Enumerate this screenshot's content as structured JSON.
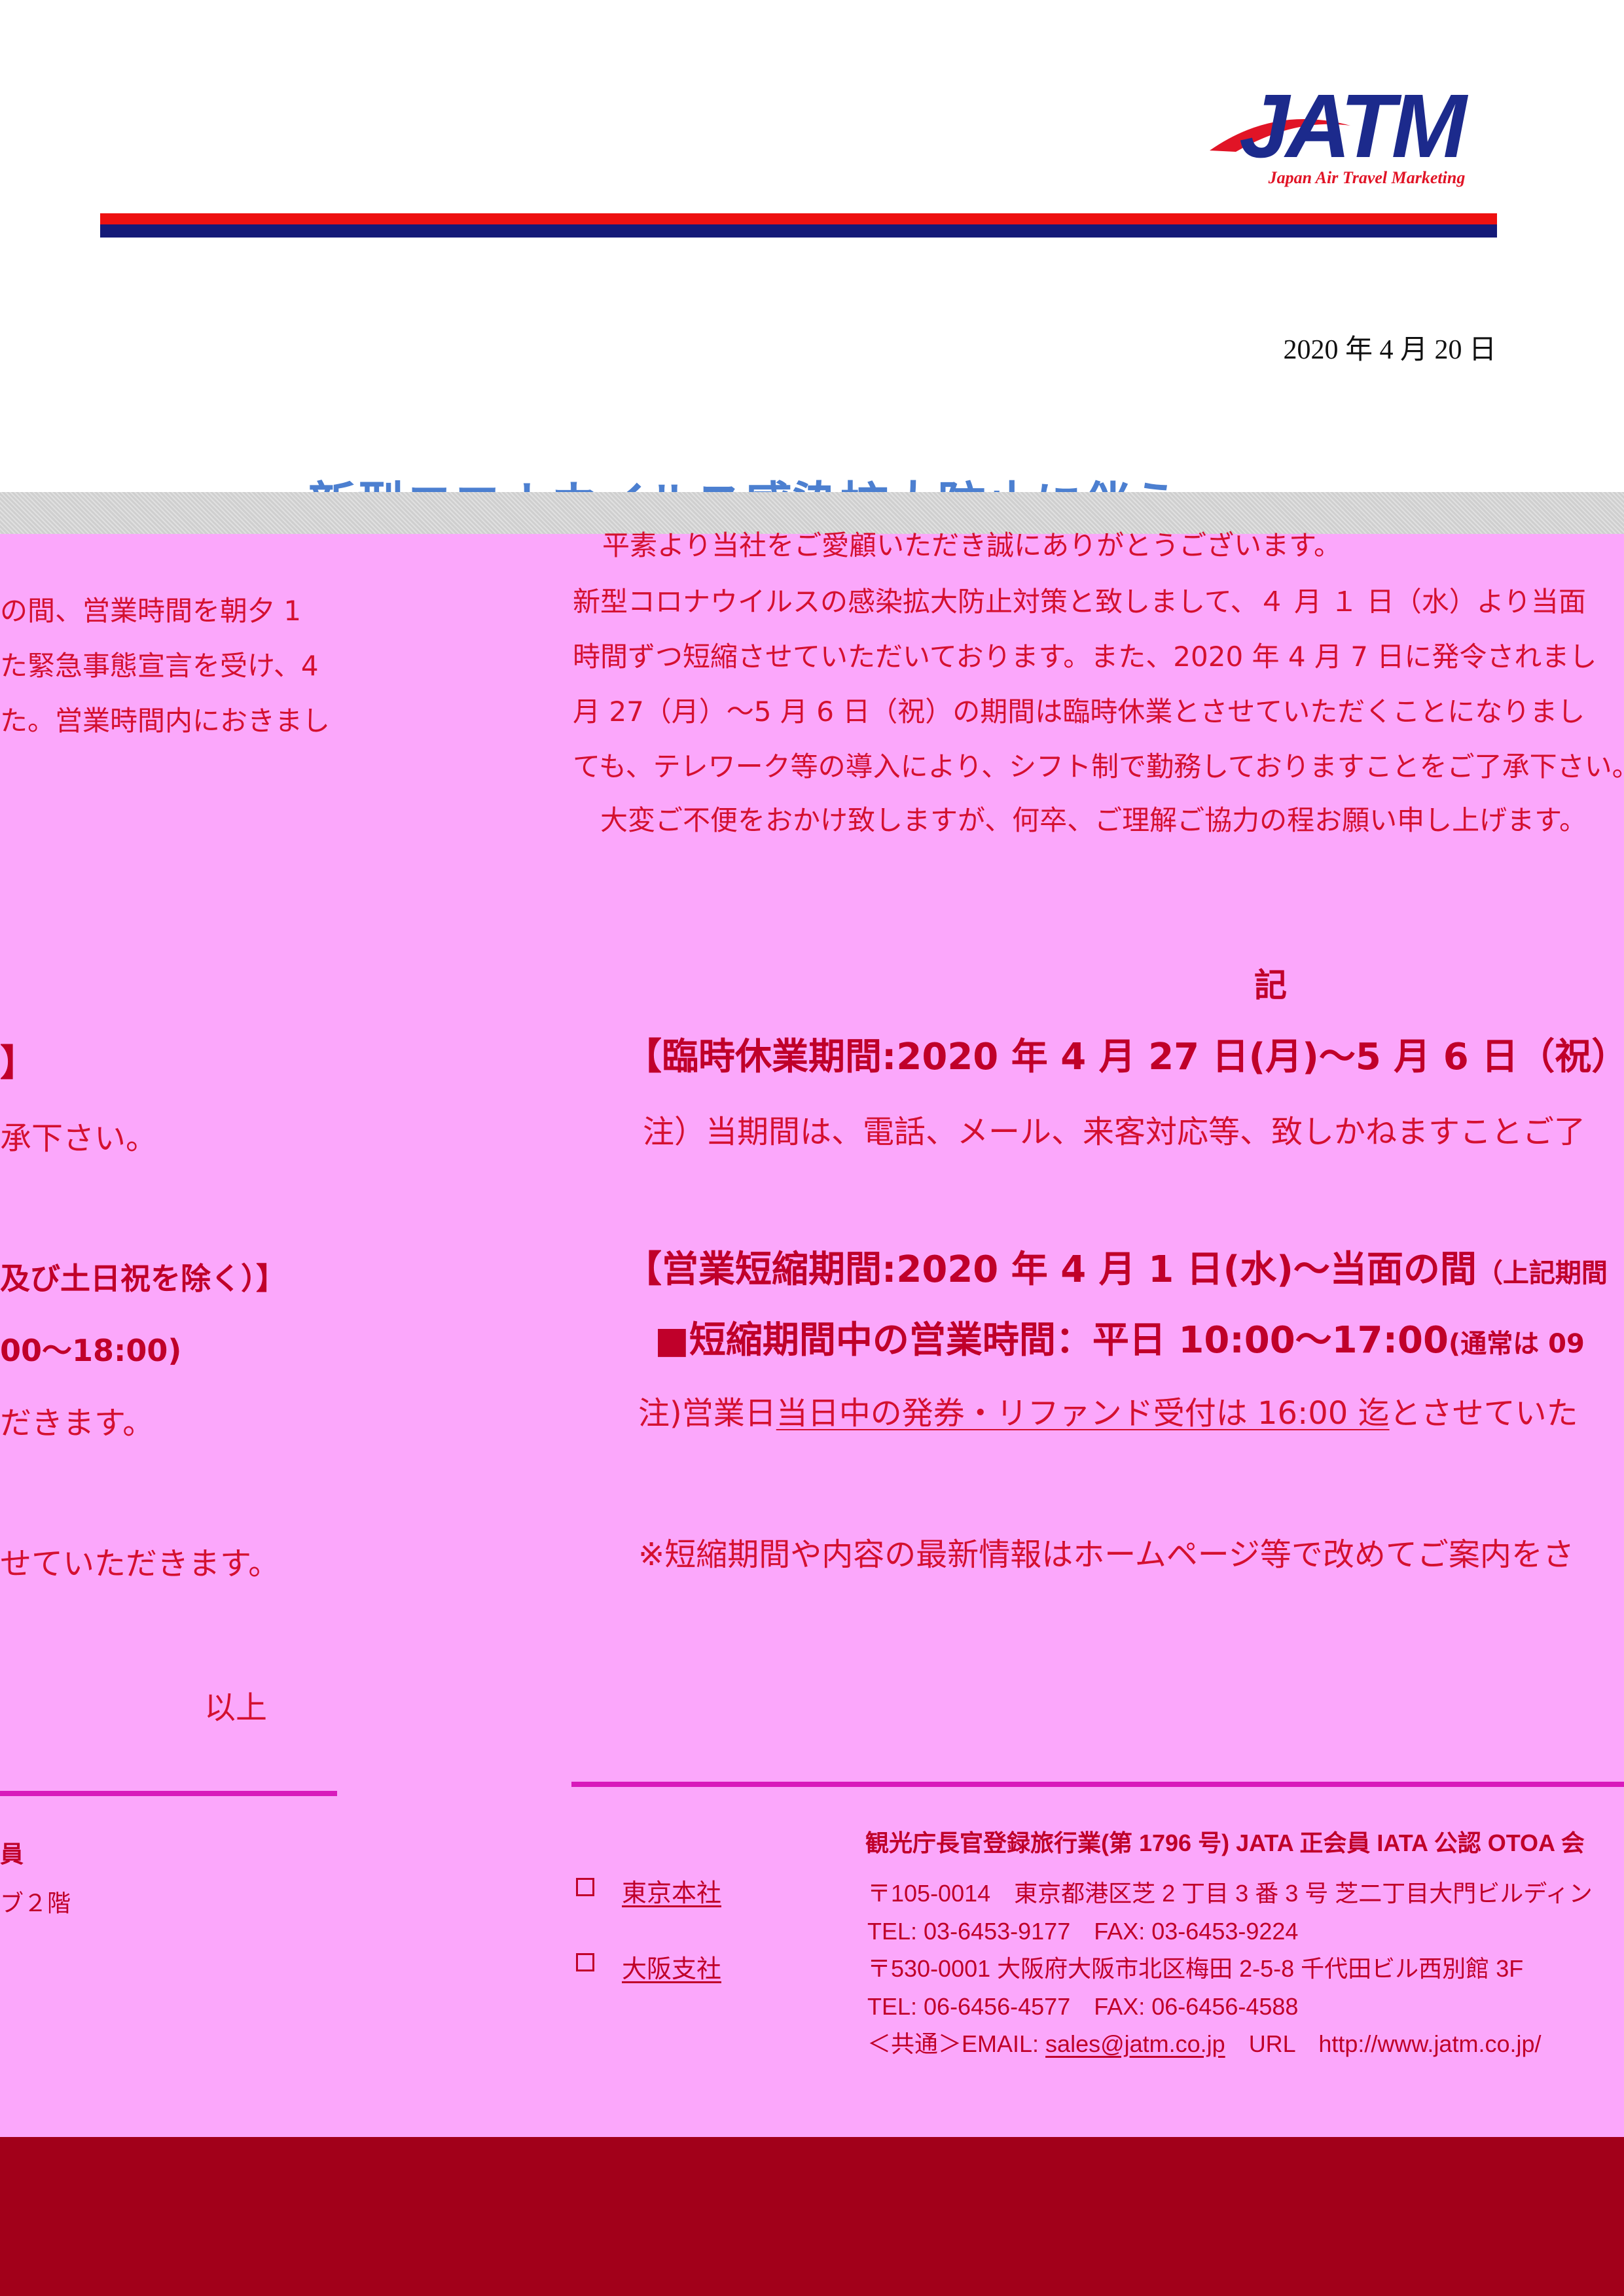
{
  "header": {
    "logo": {
      "wordmark": "JATM",
      "tagline": "Japan Air Travel Marketing",
      "colors": {
        "wordmark": "#1c2a8c",
        "swoosh": "#e11426",
        "tagline": "#e11426"
      }
    },
    "colors": {
      "rule_red": "#ee1111",
      "rule_navy": "#141a78"
    }
  },
  "date": "2020 年 4 月 20 日",
  "title": "新型コロナウイルス感染拡大防止に伴う",
  "body": {
    "greeting_partial": "平素より当社をご愛顧いただき誠にありがとうございます。",
    "para": [
      "新型コロナウイルスの感染拡大防止対策と致しまして、４ 月 １ 日（水）より当面",
      "時間ずつ短縮させていただいております。また、2020 年 4 月 7 日に発令されまし",
      "月 27（月）～5 月 6 日（祝）の期間は臨時休業とさせていただくことになりまし",
      "ても、テレワーク等の導入により、シフト制で勤務しておりますことをご了承下さい。",
      "　大変ご不便をおかけ致しますが、何卒、ご理解ご協力の程お願い申し上げます。"
    ],
    "left_fragments": [
      "の間、営業時間を朝夕 1",
      "た緊急事態宣言を受け、4",
      "た。営業時間内におきまし"
    ]
  },
  "notice": {
    "ki": "記",
    "closure_title": "【臨時休業期間:2020 年 4 月 27 日(月)～5 月 6 日（祝）",
    "closure_note": "注）当期間は、電話、メール、来客対応等、致しかねますことご了",
    "closure_left_bracket": "】",
    "closure_left_tail": "承下さい。",
    "short_title": "【営業短縮期間:2020 年 4 月 1 日(水)～当面の間",
    "short_title_small": "（上記期間",
    "short_left_tail": "及び土日祝を除く）】",
    "hours_title": "■短縮期間中の営業時間：平日 10:00～17:00",
    "hours_small": "(通常は 09",
    "hours_left_tail": "00～18:00)",
    "note2_prefix": "注)営業日",
    "note2_underlined": "当日中の発券・リファンド受付は 16:00 迄",
    "note2_suffix": "とさせていた",
    "note2_left_tail": "だきます。",
    "info_note": "※短縮期間や内容の最新情報はホームページ等で改めてご案内をさ",
    "info_left_tail": "せていただきます。",
    "ijo": "以上"
  },
  "footer": {
    "license": "観光庁長官登録旅行業(第 1796 号) JATA 正会員 IATA 公認 OTOA 会",
    "license_left": "員",
    "left_floor": "ブ２階",
    "tokyo": {
      "label": "東京本社",
      "address": "〒105-0014　東京都港区芝 2 丁目 3 番 3 号  芝二丁目大門ビルディン",
      "tel": "TEL: 03-6453-9177　FAX: 03-6453-9224"
    },
    "osaka": {
      "label": "大阪支社",
      "address": "〒530-0001  大阪府大阪市北区梅田 2-5-8  千代田ビル西別館 3F",
      "tel": "TEL: 06-6456-4577　FAX: 06-6456-4588"
    },
    "email_prefix": "＜共通＞EMAIL: ",
    "email": "sales@jatm.co.jp",
    "url_label": "　URL　",
    "url": "http://www.jatm.co.jp/"
  },
  "colors": {
    "pink_panel": "#fba7fb",
    "footer_red": "#a2001a",
    "text_red": "#d41030",
    "magenta_rule": "#d81abb",
    "title_blue": "#4c7fd0"
  }
}
